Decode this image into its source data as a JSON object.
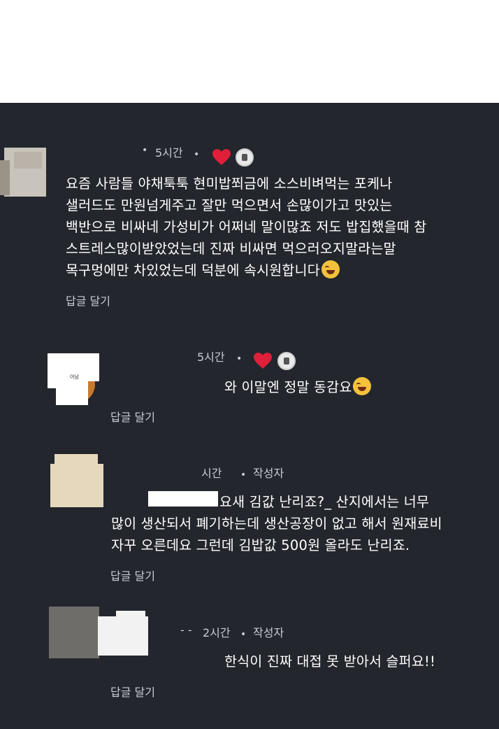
{
  "comments": [
    {
      "time": "5시간",
      "lines": [
        "요즘 사람들 야채툭툭 현미밥쬐금에 소스비벼먹는 포케나",
        "샐러드도 만원넘게주고 잘만 먹으면서 손많이가고 맛있는",
        "백반으로 비싸네 가성비가 어쩌네 말이많죠 저도 밥집했을때 참",
        "스트레스많이받았었는데 진짜 비싸면 먹으러오지말라는말",
        "목구멍에만 차있었는데 덕분에 속시원합니다"
      ],
      "reply_label": "답글 달기"
    },
    {
      "time": "5시간",
      "lines": [
        "와 이말엔 정말 동감요"
      ],
      "reply_label": "답글 달기"
    },
    {
      "time": "시간",
      "author_tag": "작성자",
      "lines": [
        "요새 김값 난리죠?_ 산지에서는 너무",
        "많이 생산되서 폐기하는데 생산공장이 없고 해서 원재료비",
        "자꾸 오른데요 그런데 김밥값 500원 올라도 난리죠."
      ],
      "reply_label": "답글 달기"
    },
    {
      "time": "2시간",
      "author_tag": "작성자",
      "lines": [
        "한식이 진짜 대접 못 받아서 슬퍼요!!"
      ],
      "reply_label": "답글 달기"
    }
  ],
  "colors": {
    "panel": "#23262d",
    "text": "#ffffff",
    "meta": "#c9ccd2",
    "heart": "#e0203a"
  },
  "icons": [
    "heart-icon",
    "laughing-emoji-icon",
    "creator-avatar-icon"
  ]
}
